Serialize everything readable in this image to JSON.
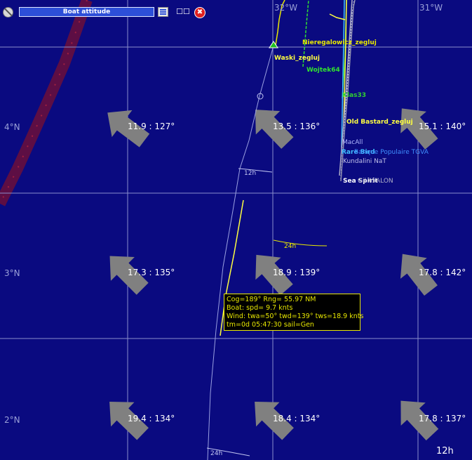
{
  "window": {
    "title": "Boat attitude",
    "config_glyph": "☐☐",
    "close_glyph": "✖"
  },
  "grid": {
    "lon_labels": [
      "32°W",
      "31°W"
    ],
    "lat_labels": [
      "4°N",
      "3°N",
      "2°N"
    ]
  },
  "wind_barbs": [
    {
      "speed_dir": "11.9 : 127°",
      "heading_deg": 127
    },
    {
      "speed_dir": "13.5 : 136°",
      "heading_deg": 136
    },
    {
      "speed_dir": "15.1 : 140°",
      "heading_deg": 140
    },
    {
      "speed_dir": "17.3 : 135°",
      "heading_deg": 135
    },
    {
      "speed_dir": "18.9 : 139°",
      "heading_deg": 139
    },
    {
      "speed_dir": "17.8 : 142°",
      "heading_deg": 142
    },
    {
      "speed_dir": "19.4 : 134°",
      "heading_deg": 134
    },
    {
      "speed_dir": "18.4 : 134°",
      "heading_deg": 134
    },
    {
      "speed_dir": "17.8 : 137°",
      "heading_deg": 137
    }
  ],
  "boats": [
    {
      "name": "Nieregalowicz_zegluj",
      "color": "#e8e800"
    },
    {
      "name": "Waski_zegluj",
      "color": "#ffff40"
    },
    {
      "name": "Wojtek64",
      "color": "#30e030"
    },
    {
      "name": "Klas33",
      "color": "#30d030"
    },
    {
      "name": "Old Bastard_zegluj",
      "color": "#ffff40"
    },
    {
      "name": "MacAll",
      "color": "#b0b8ff"
    },
    {
      "name": "Rare Bird",
      "color": "#40c0ff"
    },
    {
      "name": "Banque Populaire TGVA",
      "color": "#4090ff"
    },
    {
      "name": "Kundalini NaT",
      "color": "#c0c0e8"
    },
    {
      "name": "Sea Spirit",
      "color": "#ffffff"
    },
    {
      "name": "Gil AVALON",
      "color": "#b0b0c8"
    }
  ],
  "isochrone_labels": [
    "12h",
    "24h",
    "24h"
  ],
  "time_scale": "12h",
  "info_box": {
    "line1": "Cog=189° Rng= 55.97 NM",
    "line2": "Boat: spd= 9.7 knts",
    "line3": "Wind: twa=50° twd=139° tws=18.9 knts",
    "line4": "tm=0d 05:47:30 sail=Gen"
  },
  "colors": {
    "sea": "#0a0a80",
    "grid": "#8a8ecc",
    "arrow": "#808080",
    "route": "#9aa0e0",
    "info_text": "#e8e800"
  }
}
